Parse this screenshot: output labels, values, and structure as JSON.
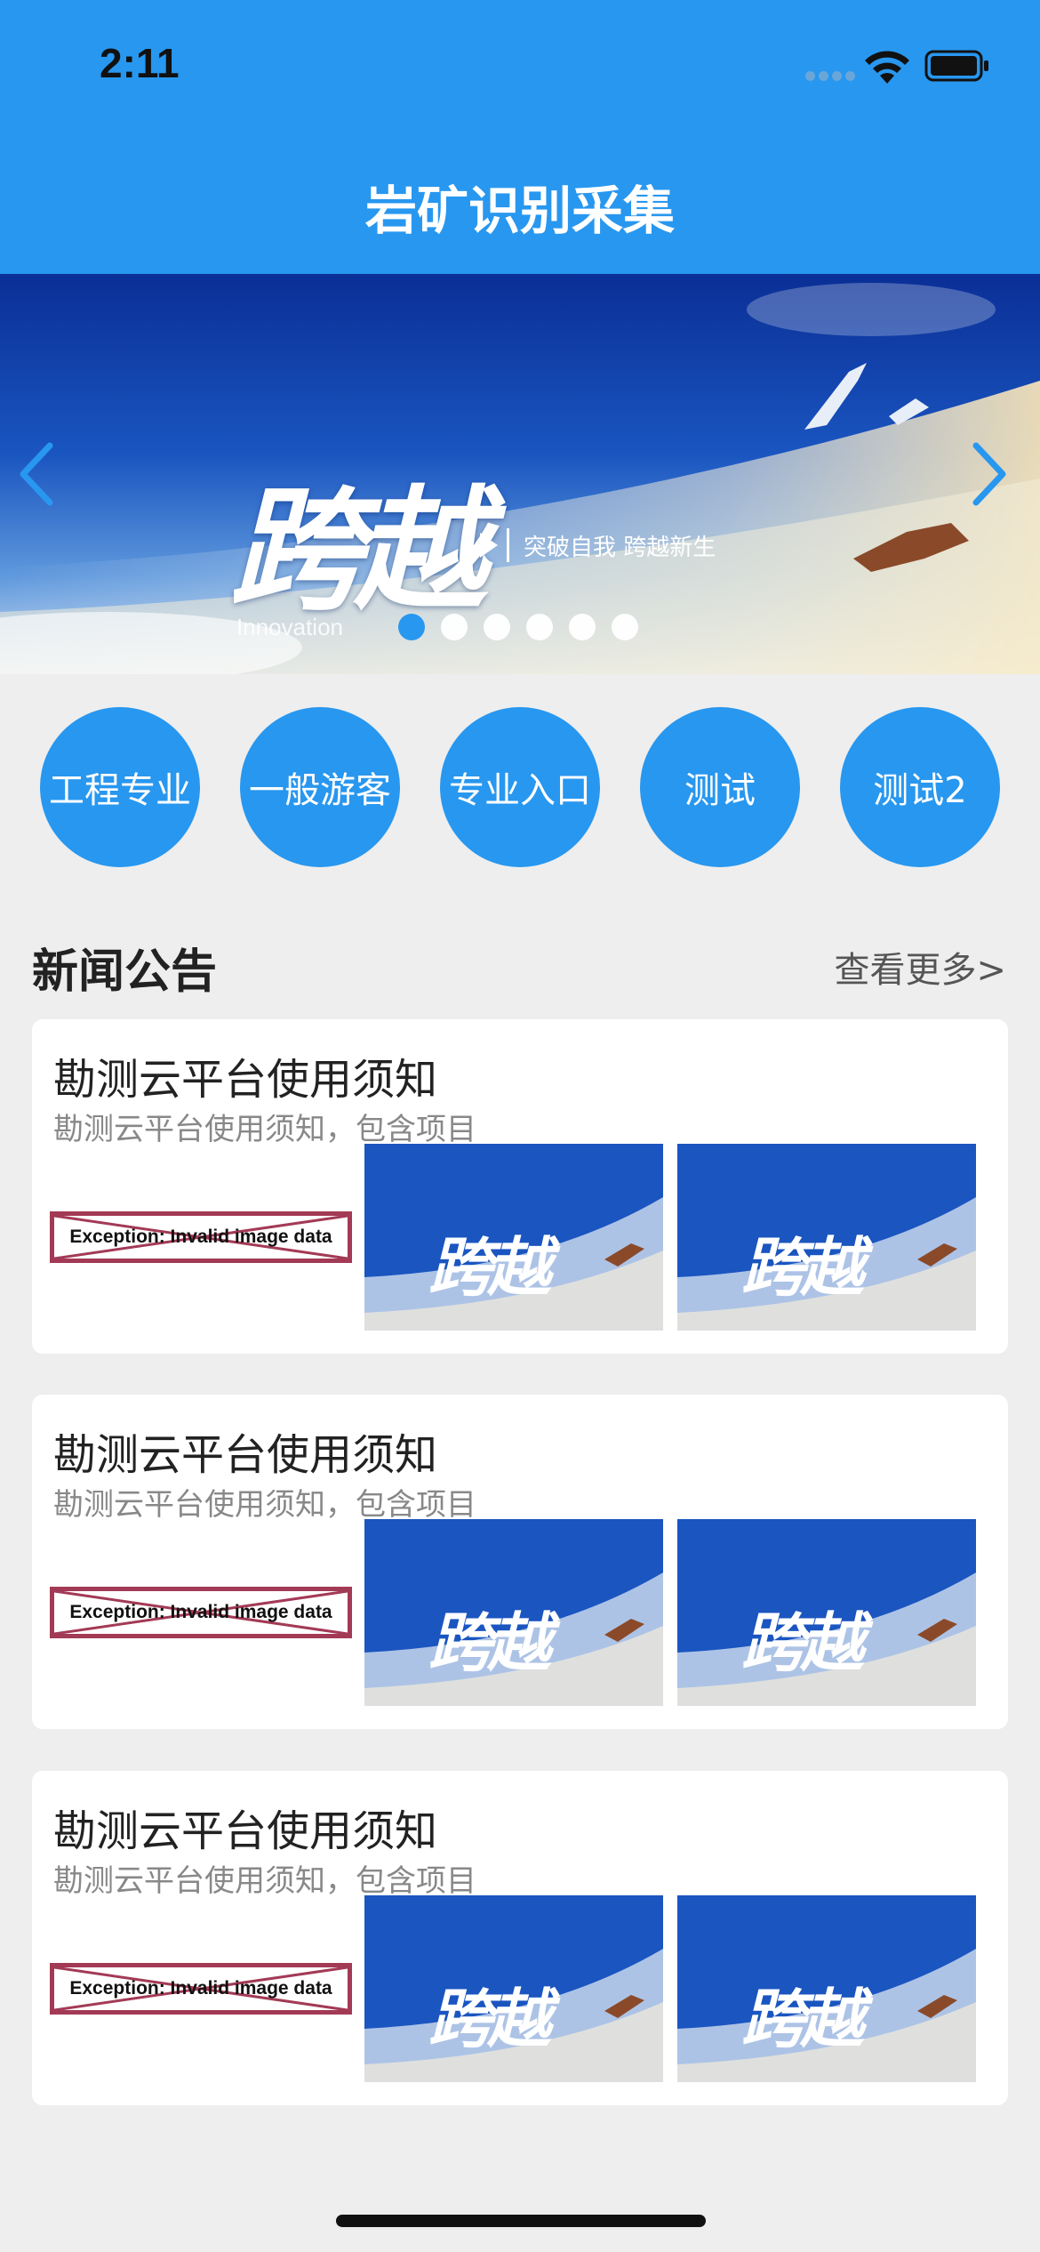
{
  "status_bar": {
    "time": "2:11"
  },
  "header": {
    "title": "岩矿识别采集"
  },
  "banner": {
    "calligraphy": "跨越",
    "slogan": "突破自我  跨越新生",
    "english": "Innovation",
    "dots_count": 6,
    "active_dot": 0
  },
  "categories": [
    {
      "label": "工程专业"
    },
    {
      "label": "一般游客"
    },
    {
      "label": "专业入口"
    },
    {
      "label": "测试"
    },
    {
      "label": "测试2"
    }
  ],
  "news": {
    "title": "新闻公告",
    "more": "查看更多>",
    "items": [
      {
        "title": "勘测云平台使用须知",
        "subtitle": "勘测云平台使用须知，包含项目",
        "broken_image_text": "Exception: Invalid image data"
      },
      {
        "title": "勘测云平台使用须知",
        "subtitle": "勘测云平台使用须知，包含项目",
        "broken_image_text": "Exception: Invalid image data"
      },
      {
        "title": "勘测云平台使用须知",
        "subtitle": "勘测云平台使用须知，包含项目",
        "broken_image_text": "Exception: Invalid image data"
      }
    ]
  },
  "colors": {
    "brand": "#2897ef",
    "broken_border": "#a33a55",
    "background": "#eeeeee"
  }
}
